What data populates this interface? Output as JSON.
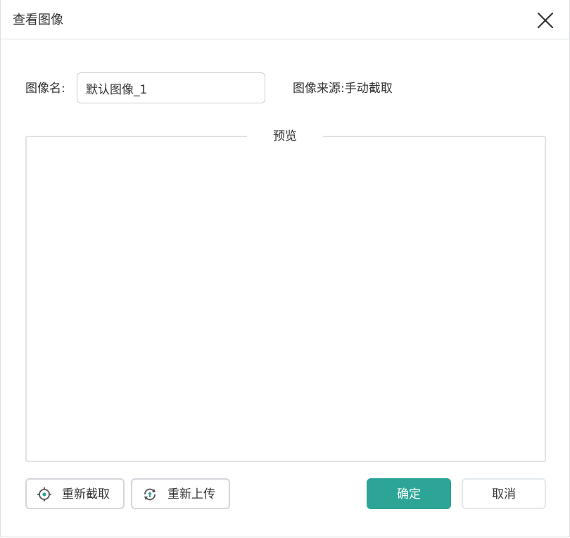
{
  "dialog": {
    "title": "查看图像",
    "accent_color": "#2ca597",
    "close_icon": "close-icon"
  },
  "form": {
    "name_label": "图像名:",
    "name_value": "默认图像_1",
    "source_text": "图像来源:手动截取"
  },
  "preview": {
    "legend": "预览"
  },
  "actions": {
    "recapture_label": "重新截取",
    "recapture_icon": "crosshair-icon",
    "reupload_label": "重新上传",
    "reupload_icon": "refresh-upload-icon",
    "ok_label": "确定",
    "cancel_label": "取消"
  }
}
